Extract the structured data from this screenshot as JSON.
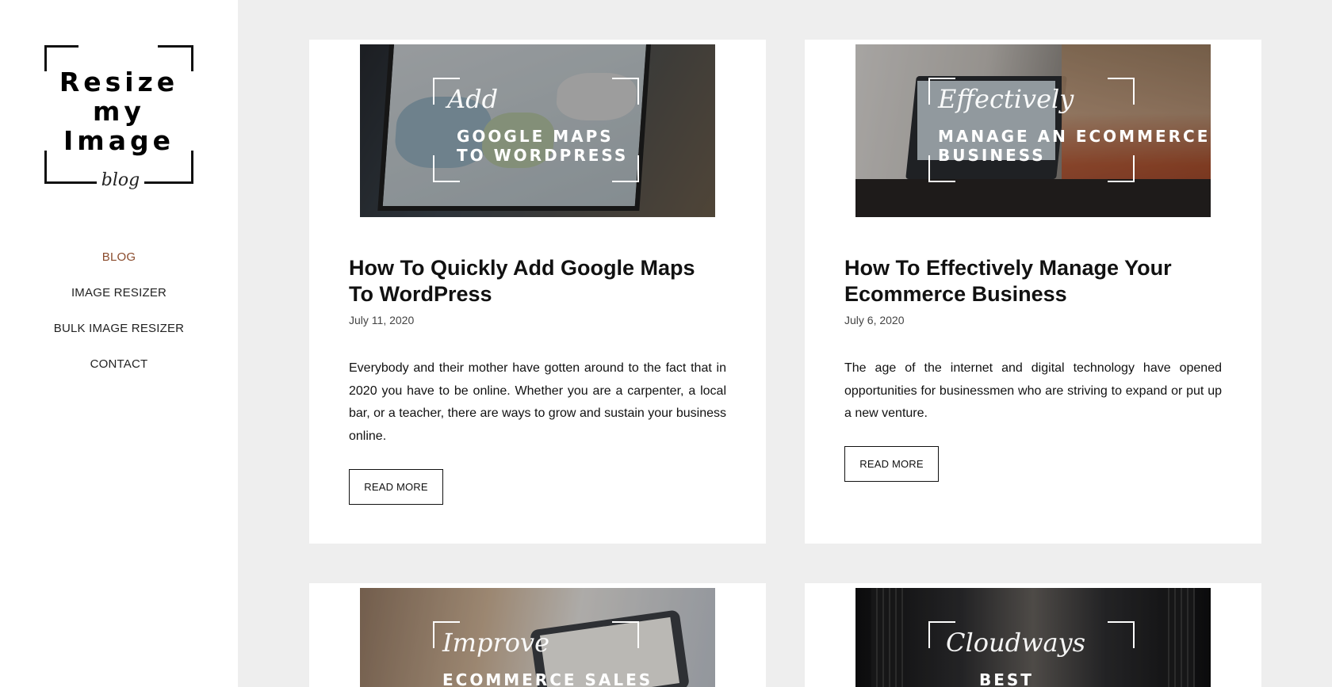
{
  "sidebar": {
    "logo": {
      "line1": "Resize",
      "line2": "my",
      "line3": "Image",
      "tagline": "blog"
    },
    "nav": [
      {
        "label": "BLOG",
        "active": true
      },
      {
        "label": "IMAGE RESIZER",
        "active": false
      },
      {
        "label": "BULK IMAGE RESIZER",
        "active": false
      },
      {
        "label": "CONTACT",
        "active": false
      }
    ]
  },
  "posts": [
    {
      "thumb_script": "Add",
      "thumb_caption": "GOOGLE MAPS\nTO WORDPRESS",
      "title": "How To Quickly Add Google Maps To WordPress",
      "date": "July 11, 2020",
      "excerpt": "Everybody and their mother have gotten around to the fact that in 2020 you have to be online. Whether you are a carpenter, a local bar, or a teacher, there are ways to grow and sustain your business online.",
      "read_more": "READ MORE"
    },
    {
      "thumb_script": "Effectively",
      "thumb_caption": "MANAGE AN ECOMMERCE\nBUSINESS",
      "title": "How To Effectively Manage Your Ecommerce Business",
      "date": "July 6, 2020",
      "excerpt": "The age of the internet and digital technology have opened opportunities for businessmen who are striving to expand or put up a new venture.",
      "read_more": "READ MORE"
    },
    {
      "thumb_script": "Improve",
      "thumb_caption": "ECOMMERCE SALES WITH"
    },
    {
      "thumb_script": "Cloudways",
      "thumb_caption": "BEST WOOCOMMERCE"
    }
  ],
  "colors": {
    "accent": "#8a4b2c",
    "background": "#eeeeee"
  }
}
